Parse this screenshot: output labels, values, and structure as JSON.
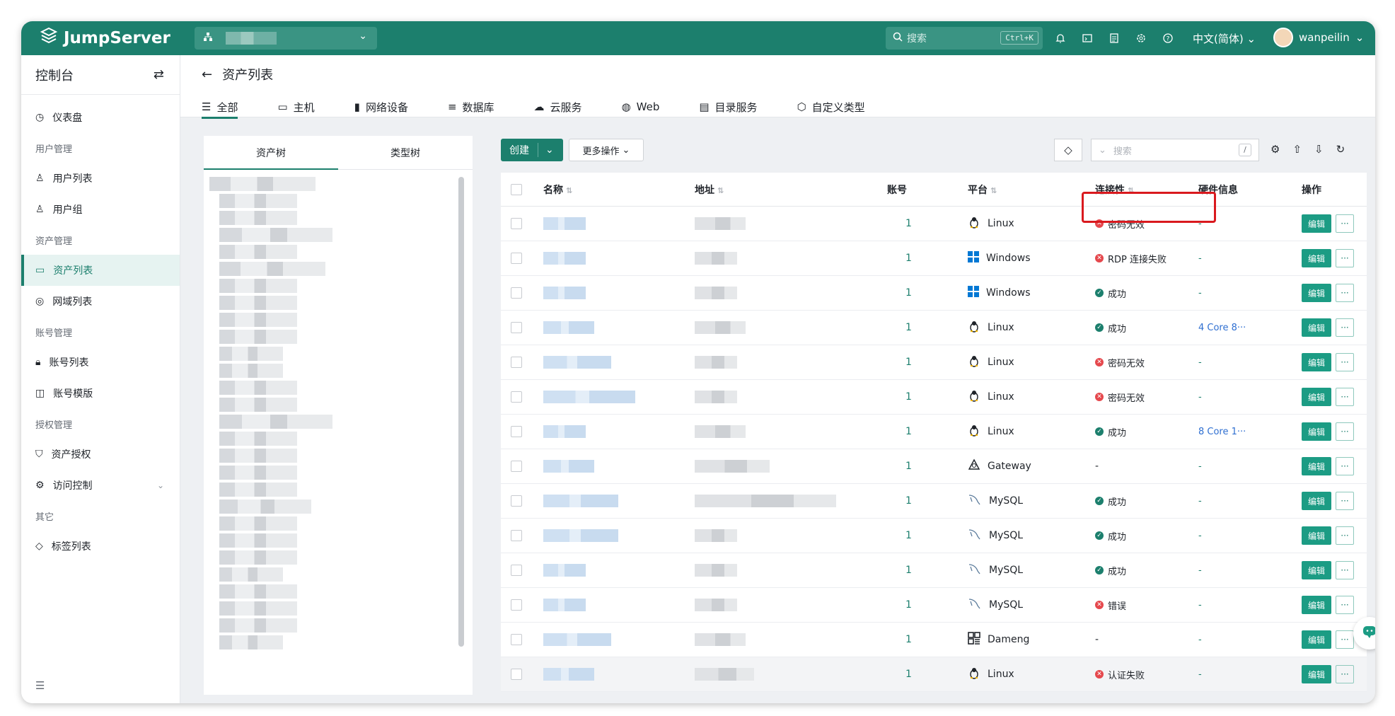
{
  "header": {
    "logo_text": "JumpServer",
    "search_placeholder": "搜索",
    "search_shortcut": "Ctrl+K",
    "language": "中文(简体)",
    "username": "wanpeilin"
  },
  "sidebar": {
    "console_label": "控制台",
    "dashboard": "仪表盘",
    "sections": {
      "user_mgmt": "用户管理",
      "user_list": "用户列表",
      "user_group": "用户组",
      "asset_mgmt": "资产管理",
      "asset_list": "资产列表",
      "domain_list": "网域列表",
      "account_mgmt": "账号管理",
      "account_list": "账号列表",
      "account_template": "账号模版",
      "perm_mgmt": "授权管理",
      "asset_perm": "资产授权",
      "access_control": "访问控制",
      "other": "其它",
      "label_list": "标签列表"
    }
  },
  "page": {
    "title": "资产列表",
    "tabs": [
      "全部",
      "主机",
      "网络设备",
      "数据库",
      "云服务",
      "Web",
      "目录服务",
      "自定义类型"
    ]
  },
  "tree": {
    "tab_asset": "资产树",
    "tab_type": "类型树"
  },
  "toolbar": {
    "create": "创建",
    "more": "更多操作",
    "search_placeholder": "搜索",
    "slash": "/"
  },
  "table": {
    "headers": {
      "name": "名称",
      "address": "地址",
      "accounts": "账号",
      "platform": "平台",
      "connectivity": "连接性",
      "hardware": "硬件信息",
      "actions": "操作"
    },
    "edit_label": "编辑",
    "rows": [
      {
        "accounts": "1",
        "platform": "Linux",
        "icon": "linux-icon",
        "status": "密码无效",
        "state": "err",
        "hw": "-"
      },
      {
        "accounts": "1",
        "platform": "Windows",
        "icon": "windows-icon",
        "status": "RDP 连接失败",
        "state": "err",
        "hw": "-"
      },
      {
        "accounts": "1",
        "platform": "Windows",
        "icon": "windows-icon",
        "status": "成功",
        "state": "ok",
        "hw": "-"
      },
      {
        "accounts": "1",
        "platform": "Linux",
        "icon": "linux-icon",
        "status": "成功",
        "state": "ok",
        "hw": "4 Core 8···"
      },
      {
        "accounts": "1",
        "platform": "Linux",
        "icon": "linux-icon",
        "status": "密码无效",
        "state": "err",
        "hw": "-"
      },
      {
        "accounts": "1",
        "platform": "Linux",
        "icon": "linux-icon",
        "status": "密码无效",
        "state": "err",
        "hw": "-"
      },
      {
        "accounts": "1",
        "platform": "Linux",
        "icon": "linux-icon",
        "status": "成功",
        "state": "ok",
        "hw": "8 Core 1···"
      },
      {
        "accounts": "1",
        "platform": "Gateway",
        "icon": "gateway-icon",
        "status": "-",
        "state": "none",
        "hw": "-"
      },
      {
        "accounts": "1",
        "platform": "MySQL",
        "icon": "mysql-icon",
        "status": "成功",
        "state": "ok",
        "hw": "-"
      },
      {
        "accounts": "1",
        "platform": "MySQL",
        "icon": "mysql-icon",
        "status": "成功",
        "state": "ok",
        "hw": "-"
      },
      {
        "accounts": "1",
        "platform": "MySQL",
        "icon": "mysql-icon",
        "status": "成功",
        "state": "ok",
        "hw": "-"
      },
      {
        "accounts": "1",
        "platform": "MySQL",
        "icon": "mysql-icon",
        "status": "错误",
        "state": "err",
        "hw": "-"
      },
      {
        "accounts": "1",
        "platform": "Dameng",
        "icon": "dameng-icon",
        "status": "-",
        "state": "none",
        "hw": "-"
      },
      {
        "accounts": "1",
        "platform": "Linux",
        "icon": "linux-icon",
        "status": "认证失败",
        "state": "err",
        "hw": "-"
      }
    ]
  },
  "colors": {
    "brand": "#1c7f6d",
    "error": "#e5484d",
    "highlight_box": "#d9191e"
  }
}
